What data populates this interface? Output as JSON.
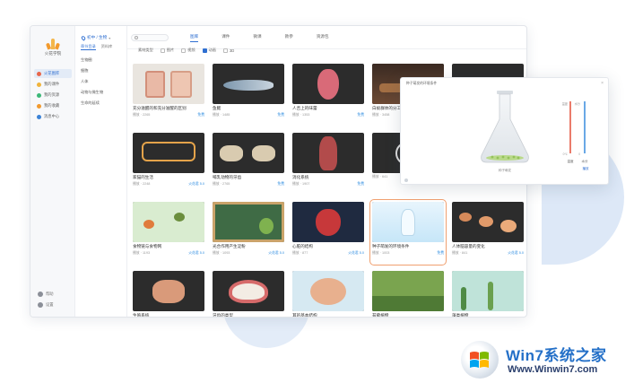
{
  "app": {
    "brand_name": "火花学院",
    "grade_label": "初中 / 生物",
    "subtabs": [
      "章节目录",
      "资料库"
    ],
    "chapters": [
      "生物圈",
      "细胞",
      "人体",
      "动物与微生物",
      "生命的延续"
    ]
  },
  "rail": {
    "items": [
      {
        "label": "火花图库",
        "color": "#e8664a",
        "active": true
      },
      {
        "label": "我的课件",
        "color": "#f0b43c",
        "active": false
      },
      {
        "label": "我的资源",
        "color": "#3cb878",
        "active": false
      },
      {
        "label": "我的收藏",
        "color": "#f29a2e",
        "active": false
      },
      {
        "label": "消息中心",
        "color": "#3b82d6",
        "active": false
      }
    ],
    "bottom": [
      {
        "label": "帮助"
      },
      {
        "label": "设置"
      }
    ]
  },
  "topbar": {
    "search_placeholder": "",
    "tabs": [
      {
        "label": "图库",
        "active": true
      },
      {
        "label": "课件",
        "active": false
      },
      {
        "label": "微课",
        "active": false
      },
      {
        "label": "教参",
        "active": false
      },
      {
        "label": "资源包",
        "active": false
      }
    ],
    "filter_label": "素材类型",
    "filters": [
      {
        "label": "图片",
        "checked": false
      },
      {
        "label": "视频",
        "checked": false
      },
      {
        "label": "动画",
        "checked": true
      },
      {
        "label": "3D",
        "checked": false
      }
    ]
  },
  "grid": {
    "cards": [
      {
        "title": "充分滋醒的和充分滋醒的区别",
        "meta": "播放 · 2265",
        "tag": "免费",
        "thumb": "cells"
      },
      {
        "title": "鱼鳃",
        "meta": "播放 · 1485",
        "tag": "免费",
        "thumb": "fish"
      },
      {
        "title": "人舌上的味蕾",
        "meta": "播放 · 1353",
        "tag": "免费",
        "thumb": "tongue"
      },
      {
        "title": "白蚁群体的分工",
        "meta": "播放 · 3458",
        "tag": "免费",
        "thumb": "ants"
      },
      {
        "title": "",
        "meta": "",
        "tag": "",
        "thumb": "blank"
      },
      {
        "title": "家猫的生活",
        "meta": "播放 · 2248",
        "tag": "火花君 5.0",
        "thumb": "neuron"
      },
      {
        "title": "哺乳动物的牙齿",
        "meta": "播放 · 2765",
        "tag": "免费",
        "thumb": "skull"
      },
      {
        "title": "消化系统",
        "meta": "播放 · 1907",
        "tag": "免费",
        "thumb": "body"
      },
      {
        "title": "",
        "meta": "播放 · 641",
        "tag": "",
        "thumb": "bulb"
      },
      {
        "title": "",
        "meta": "",
        "tag": "",
        "thumb": "blank"
      },
      {
        "title": "食物链与食物网",
        "meta": "播放 · 1193",
        "tag": "火花君 5.0",
        "thumb": "foodweb"
      },
      {
        "title": "光合作用产生淀粉",
        "meta": "播放 · 1093",
        "tag": "火花君 5.0",
        "thumb": "board"
      },
      {
        "title": "心脏的结构",
        "meta": "播放 · 877",
        "tag": "火花君 5.0",
        "thumb": "heart"
      },
      {
        "title": "种子萌发的环境条件",
        "meta": "播放 · 1003",
        "tag": "免费",
        "thumb": "flask",
        "selected": true
      },
      {
        "title": "人体脑容量的变化",
        "meta": "播放 · 841",
        "tag": "火花君 5.0",
        "thumb": "skulls"
      },
      {
        "title": "生殖系统",
        "meta": "播放 · 2253",
        "tag": "火花君 5.0",
        "thumb": "organ"
      },
      {
        "title": "牙齿的类型",
        "meta": "播放 · 1047",
        "tag": "火花君 5.0",
        "thumb": "teeth"
      },
      {
        "title": "耳的基本结构",
        "meta": "播放 · 1049",
        "tag": "火花君 5.0",
        "thumb": "ear"
      },
      {
        "title": "苔藓植物",
        "meta": "播放 · 1042",
        "tag": "火花君 5.0",
        "thumb": "moss"
      },
      {
        "title": "藻类植物",
        "meta": "播放 · 981",
        "tag": "火花君 5.0",
        "thumb": "algae"
      }
    ]
  },
  "popup": {
    "title": "种子萌发的环境条件",
    "flask_label": "种子萌发",
    "left_scale_top": "温度",
    "left_scale_bottom": "0℃",
    "right_scale_top": "水分",
    "right_scale_bottom": "0",
    "left_caption": "温度",
    "right_caption": "水分",
    "button_label": "播放"
  },
  "watermark": {
    "title": "Win7系统之家",
    "url": "Www.Winwin7.com"
  }
}
